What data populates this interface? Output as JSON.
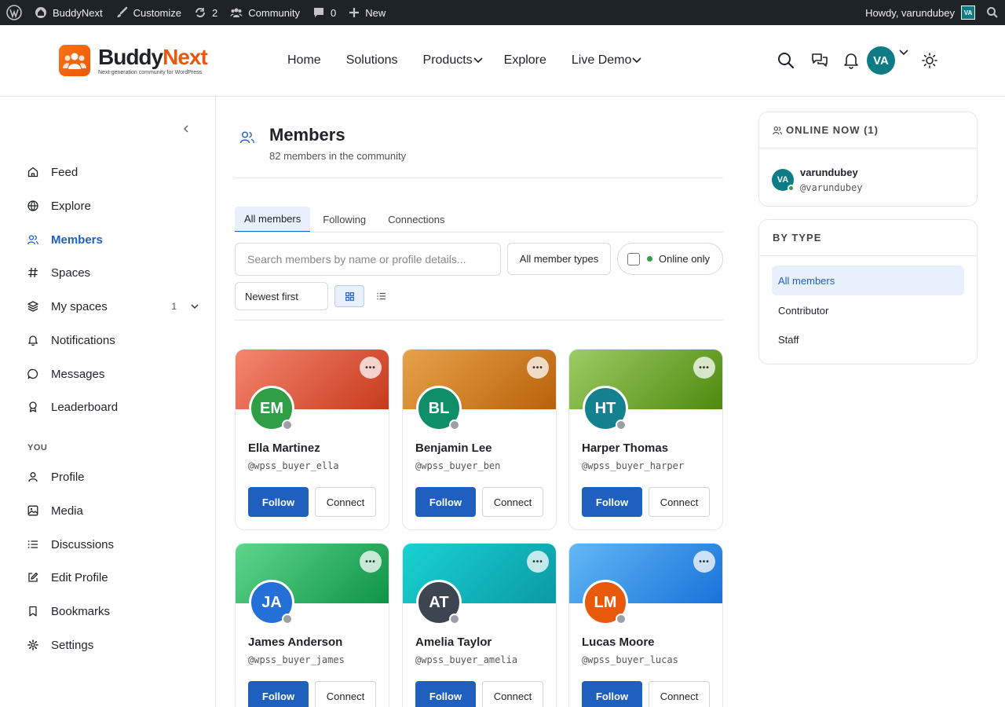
{
  "adminbar": {
    "site_name": "BuddyNext",
    "customize": "Customize",
    "updates_count": "2",
    "community": "Community",
    "comments_count": "0",
    "new": "New",
    "howdy": "Howdy, varundubey",
    "avatar_initials": "VA"
  },
  "header": {
    "logo_name_part1": "Buddy",
    "logo_name_part2": "Next",
    "logo_tagline": "Next-generation community for WordPress",
    "nav": [
      {
        "label": "Home"
      },
      {
        "label": "Solutions"
      },
      {
        "label": "Products"
      },
      {
        "label": "Explore"
      },
      {
        "label": "Live Demo"
      }
    ],
    "user_initials": "VA"
  },
  "sidebar": {
    "items": [
      {
        "label": "Feed"
      },
      {
        "label": "Explore"
      },
      {
        "label": "Members"
      },
      {
        "label": "Spaces"
      },
      {
        "label": "My spaces",
        "count": "1"
      },
      {
        "label": "Notifications"
      },
      {
        "label": "Messages"
      },
      {
        "label": "Leaderboard"
      }
    ],
    "section_you": "YOU",
    "you_items": [
      {
        "label": "Profile"
      },
      {
        "label": "Media"
      },
      {
        "label": "Discussions"
      },
      {
        "label": "Edit Profile"
      },
      {
        "label": "Bookmarks"
      },
      {
        "label": "Settings"
      }
    ]
  },
  "main": {
    "title": "Members",
    "subtitle": "82 members in the community",
    "tabs": [
      {
        "label": "All members"
      },
      {
        "label": "Following"
      },
      {
        "label": "Connections"
      }
    ],
    "search_placeholder": "Search members by name or profile details...",
    "member_types": "All member types",
    "online_only": "Online only",
    "sort": "Newest first",
    "follow_label": "Follow",
    "connect_label": "Connect",
    "more_label": "•••",
    "members": [
      {
        "initials": "EM",
        "name": "Ella Martinez",
        "handle": "@wpss_buyer_ella",
        "avatar_color": "#2f9e44",
        "cover_from": "#f4866f",
        "cover_to": "#c73a1c"
      },
      {
        "initials": "BL",
        "name": "Benjamin Lee",
        "handle": "@wpss_buyer_ben",
        "avatar_color": "#0e8f6a",
        "cover_from": "#e8a24a",
        "cover_to": "#b8620a"
      },
      {
        "initials": "HT",
        "name": "Harper Thomas",
        "handle": "@wpss_buyer_harper",
        "avatar_color": "#13818f",
        "cover_from": "#9ccc65",
        "cover_to": "#4e8a0e"
      },
      {
        "initials": "JA",
        "name": "James Anderson",
        "handle": "@wpss_buyer_james",
        "avatar_color": "#2470d6",
        "cover_from": "#5ed68a",
        "cover_to": "#0e9448"
      },
      {
        "initials": "AT",
        "name": "Amelia Taylor",
        "handle": "@wpss_buyer_amelia",
        "avatar_color": "#3d4650",
        "cover_from": "#19d2d2",
        "cover_to": "#0a9aa5"
      },
      {
        "initials": "LM",
        "name": "Lucas Moore",
        "handle": "@wpss_buyer_lucas",
        "avatar_color": "#e8590c",
        "cover_from": "#63b8f5",
        "cover_to": "#1872d8"
      }
    ]
  },
  "right": {
    "online_title": "ONLINE NOW (1)",
    "online_user": {
      "initials": "VA",
      "name": "varundubey",
      "handle": "@varundubey"
    },
    "by_type_title": "BY TYPE",
    "types": [
      {
        "label": "All members"
      },
      {
        "label": "Contributor"
      },
      {
        "label": "Staff"
      }
    ]
  },
  "colors": {
    "primary": "#1e5fbf",
    "admin_bar": "#1d2327",
    "online": "#2f9e44"
  }
}
